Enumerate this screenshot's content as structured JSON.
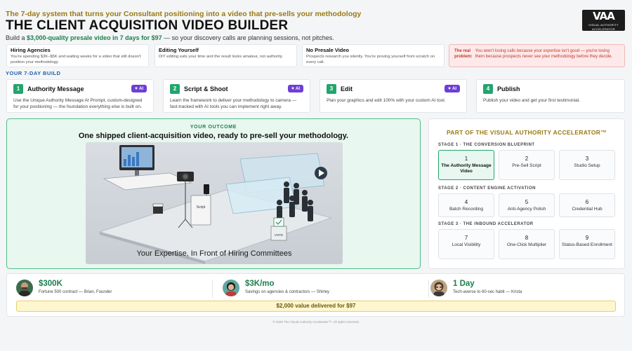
{
  "header": {
    "tagline": "The 7-day system that turns your Consultant positioning into a video that pre-sells your methodology",
    "title": "THE CLIENT ACQUISITION VIDEO BUILDER",
    "subline_pre": "Build a ",
    "subline_highlight": "$3,000-quality presale video in 7 days for $97",
    "subline_post": " — so your discovery calls are planning sessions, not pitches."
  },
  "logo": {
    "mark": "VAA",
    "sub": "VISUAL AUTHORITY ACCELERATOR"
  },
  "pains": [
    {
      "head": "Hiring Agencies",
      "text": "You're spending $3K–$5K and waiting weeks for a video that still doesn't position your methodology."
    },
    {
      "head": "Editing Yourself",
      "text": "DIY editing eats your time and the result looks amateur, not authority."
    },
    {
      "head": "No Presale Video",
      "text": "Prospects research you silently. You're proving yourself from scratch on every call."
    }
  ],
  "pain_alert": {
    "head": "The real problem:",
    "text": "You aren't losing calls because your expertise isn't good — you're losing them because prospects never see your methodology before they decide."
  },
  "build_label": "YOUR 7-DAY BUILD",
  "steps": [
    {
      "num": "1",
      "name": "Authority Message",
      "ai": "✦ AI",
      "desc": "Use the Unique Authority Message AI Prompt, custom-designed for your positioning — the foundation everything else is built on."
    },
    {
      "num": "2",
      "name": "Script & Shoot",
      "ai": "✦ AI",
      "desc": "Learn the framework to deliver your methodology to camera — fast-tracked with AI tools you can implement right away."
    },
    {
      "num": "3",
      "name": "Edit",
      "ai": "✦ AI",
      "desc": "Plan your graphics and edit 100% with your custom AI tool."
    },
    {
      "num": "4",
      "name": "Publish",
      "desc": "Publish your video and get your first testimonial."
    }
  ],
  "outcome": {
    "label": "YOUR OUTCOME",
    "headline": "One shipped client-acquisition video, ready to pre-sell your methodology.",
    "image_caption": "Your Expertise, In Front of Hiring Committees",
    "image_sign_script": "Script",
    "image_sign_vote": "VOTE"
  },
  "accelerator": {
    "title": "PART OF THE VISUAL AUTHORITY ACCELERATOR™",
    "stages": [
      {
        "label": "STAGE 1 · THE CONVERSION BLUEPRINT",
        "modules": [
          {
            "num": "1",
            "label": "The Authority Message Video",
            "active": true
          },
          {
            "num": "2",
            "label": "Pre-Sell Script"
          },
          {
            "num": "3",
            "label": "Studio Setup"
          }
        ]
      },
      {
        "label": "STAGE 2 · CONTENT ENGINE ACTIVATION",
        "modules": [
          {
            "num": "4",
            "label": "Batch Recording"
          },
          {
            "num": "5",
            "label": "Anti-Agency Polish"
          },
          {
            "num": "6",
            "label": "Credential Hub"
          }
        ]
      },
      {
        "label": "STAGE 3 · THE INBOUND ACCELERATOR",
        "modules": [
          {
            "num": "7",
            "label": "Local Visibility"
          },
          {
            "num": "8",
            "label": "One-Click Multiplier"
          },
          {
            "num": "9",
            "label": "Status-Based Enrollment"
          }
        ]
      }
    ]
  },
  "testimonials": [
    {
      "value": "$300K",
      "who": "Fortune 500 contract — Brian, Founder"
    },
    {
      "value": "$3K/mo",
      "who": "Savings on agencies & contractors — Shirley"
    },
    {
      "value": "1 Day",
      "who": "Tech-averse to 60-sec habit — Krista"
    }
  ],
  "value_bar": "$2,000 value delivered for $97",
  "footer": "© 2026 The Visual Authority Accelerator™. All rights reserved.",
  "colors": {
    "green": "#22a66e",
    "gold": "#9a7a14",
    "purple": "#6d3fd6",
    "alert": "#c0392b",
    "blue": "#1d5fa8"
  }
}
